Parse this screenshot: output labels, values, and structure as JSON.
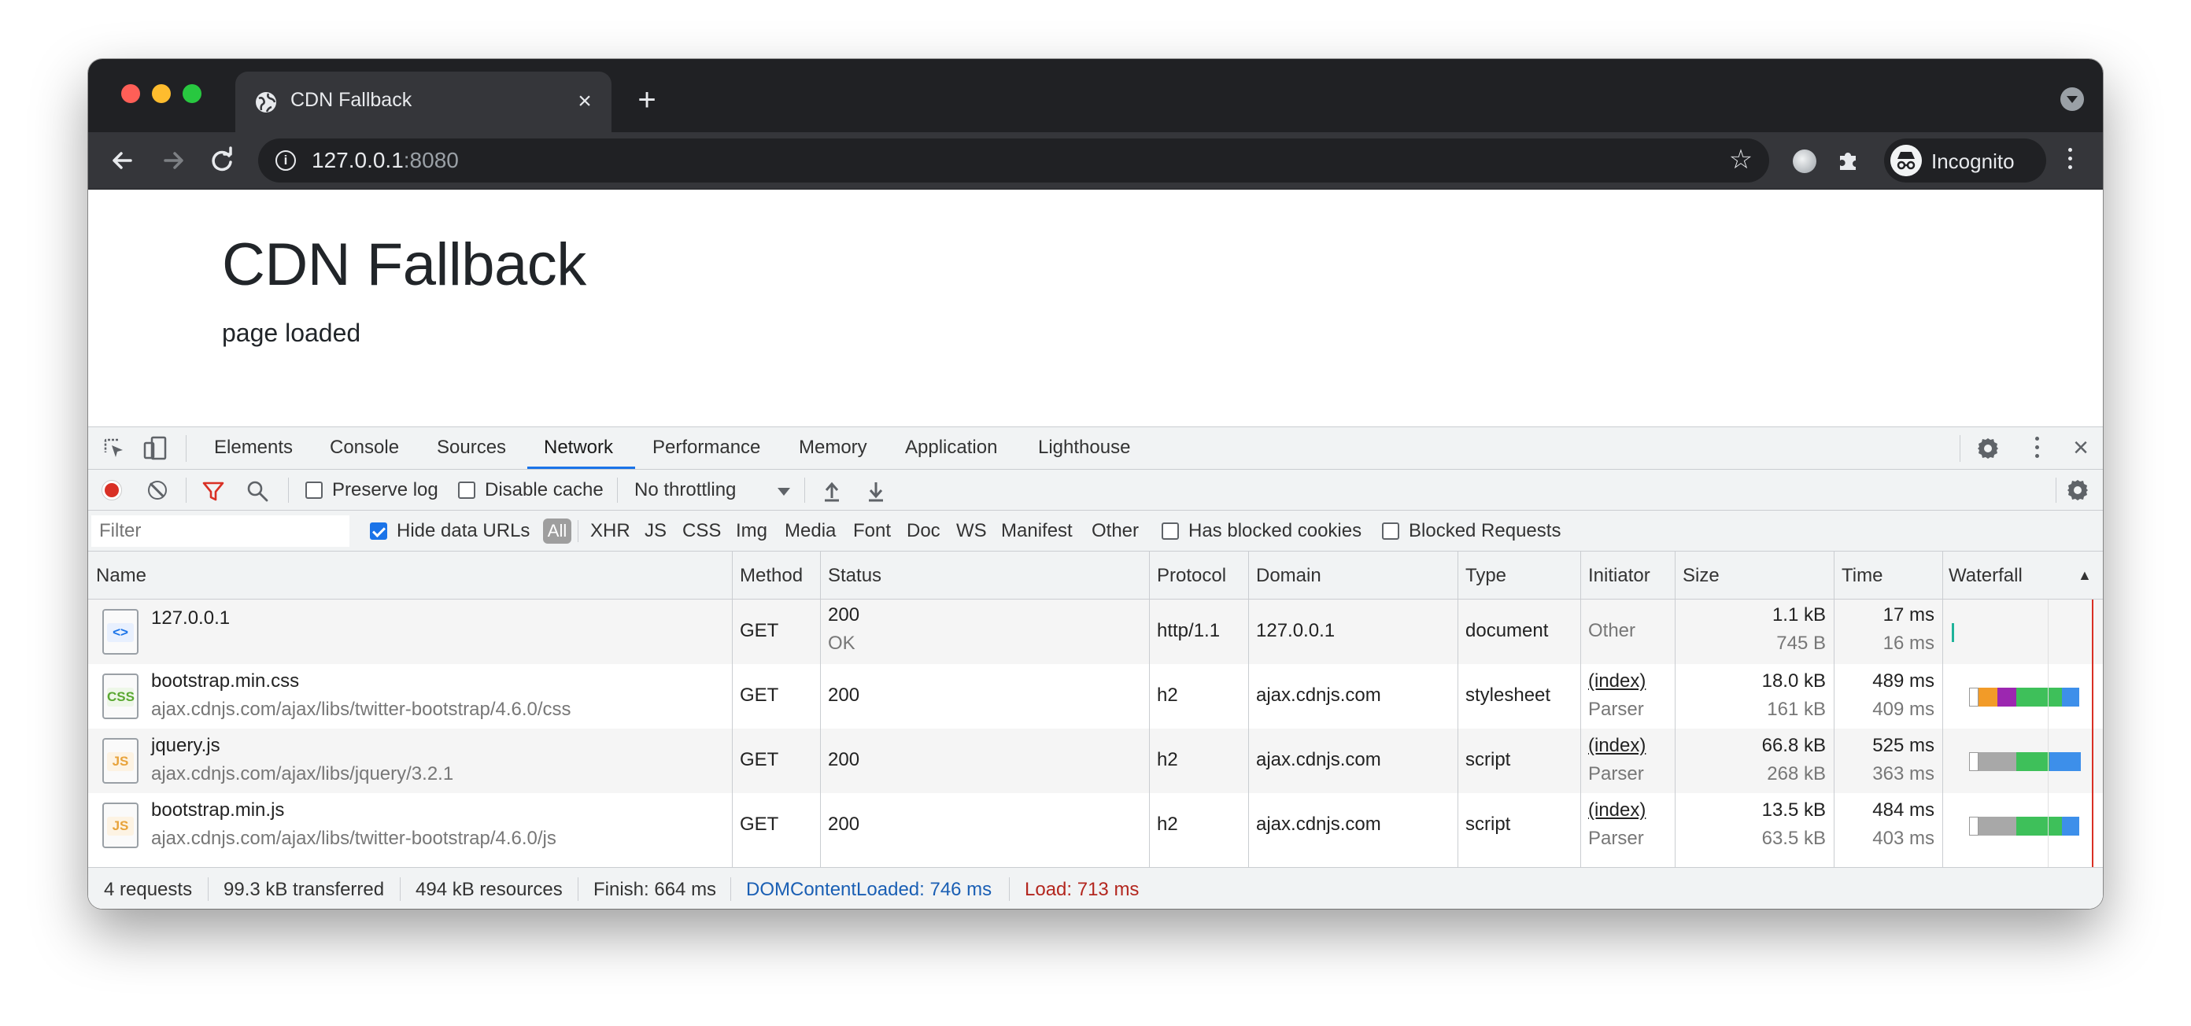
{
  "browser": {
    "tab_title": "CDN Fallback",
    "url_host": "127.0.0.1",
    "url_port": ":8080",
    "profile_label": "Incognito"
  },
  "page": {
    "heading": "CDN Fallback",
    "status": "page loaded"
  },
  "devtools": {
    "tabs": [
      "Elements",
      "Console",
      "Sources",
      "Network",
      "Performance",
      "Memory",
      "Application",
      "Lighthouse"
    ],
    "active_tab": "Network",
    "toolbar": {
      "preserve_log": "Preserve log",
      "disable_cache": "Disable cache",
      "throttling": "No throttling"
    },
    "filter": {
      "placeholder": "Filter",
      "hide_data_urls": "Hide data URLs",
      "types": [
        "All",
        "XHR",
        "JS",
        "CSS",
        "Img",
        "Media",
        "Font",
        "Doc",
        "WS",
        "Manifest",
        "Other"
      ],
      "has_blocked_cookies": "Has blocked cookies",
      "blocked_requests": "Blocked Requests"
    },
    "columns": [
      "Name",
      "Method",
      "Status",
      "Protocol",
      "Domain",
      "Type",
      "Initiator",
      "Size",
      "Time",
      "Waterfall"
    ],
    "requests": [
      {
        "name": "127.0.0.1",
        "path": "",
        "icon": "document-icon",
        "method": "GET",
        "status": "200",
        "status_text": "OK",
        "protocol": "http/1.1",
        "domain": "127.0.0.1",
        "type": "document",
        "initiator": "Other",
        "initiator_sub": "",
        "size": "1.1 kB",
        "size_sub": "745 B",
        "time": "17 ms",
        "time_sub": "16 ms"
      },
      {
        "name": "bootstrap.min.css",
        "path": "ajax.cdnjs.com/ajax/libs/twitter-bootstrap/4.6.0/css",
        "icon": "css-file-icon",
        "method": "GET",
        "status": "200",
        "status_text": "",
        "protocol": "h2",
        "domain": "ajax.cdnjs.com",
        "type": "stylesheet",
        "initiator": "(index)",
        "initiator_sub": "Parser",
        "size": "18.0 kB",
        "size_sub": "161 kB",
        "time": "489 ms",
        "time_sub": "409 ms"
      },
      {
        "name": "jquery.js",
        "path": "ajax.cdnjs.com/ajax/libs/jquery/3.2.1",
        "icon": "js-file-icon",
        "method": "GET",
        "status": "200",
        "status_text": "",
        "protocol": "h2",
        "domain": "ajax.cdnjs.com",
        "type": "script",
        "initiator": "(index)",
        "initiator_sub": "Parser",
        "size": "66.8 kB",
        "size_sub": "268 kB",
        "time": "525 ms",
        "time_sub": "363 ms"
      },
      {
        "name": "bootstrap.min.js",
        "path": "ajax.cdnjs.com/ajax/libs/twitter-bootstrap/4.6.0/js",
        "icon": "js-file-icon",
        "method": "GET",
        "status": "200",
        "status_text": "",
        "protocol": "h2",
        "domain": "ajax.cdnjs.com",
        "type": "script",
        "initiator": "(index)",
        "initiator_sub": "Parser",
        "size": "13.5 kB",
        "size_sub": "63.5 kB",
        "time": "484 ms",
        "time_sub": "403 ms"
      }
    ],
    "summary": {
      "requests": "4 requests",
      "transferred": "99.3 kB transferred",
      "resources": "494 kB resources",
      "finish": "Finish: 664 ms",
      "dcl": "DOMContentLoaded: 746 ms",
      "load": "Load: 713 ms"
    },
    "colors": {
      "dcl": "#1a5fb4",
      "load": "#b3261e",
      "accent": "#1a73e8"
    }
  }
}
